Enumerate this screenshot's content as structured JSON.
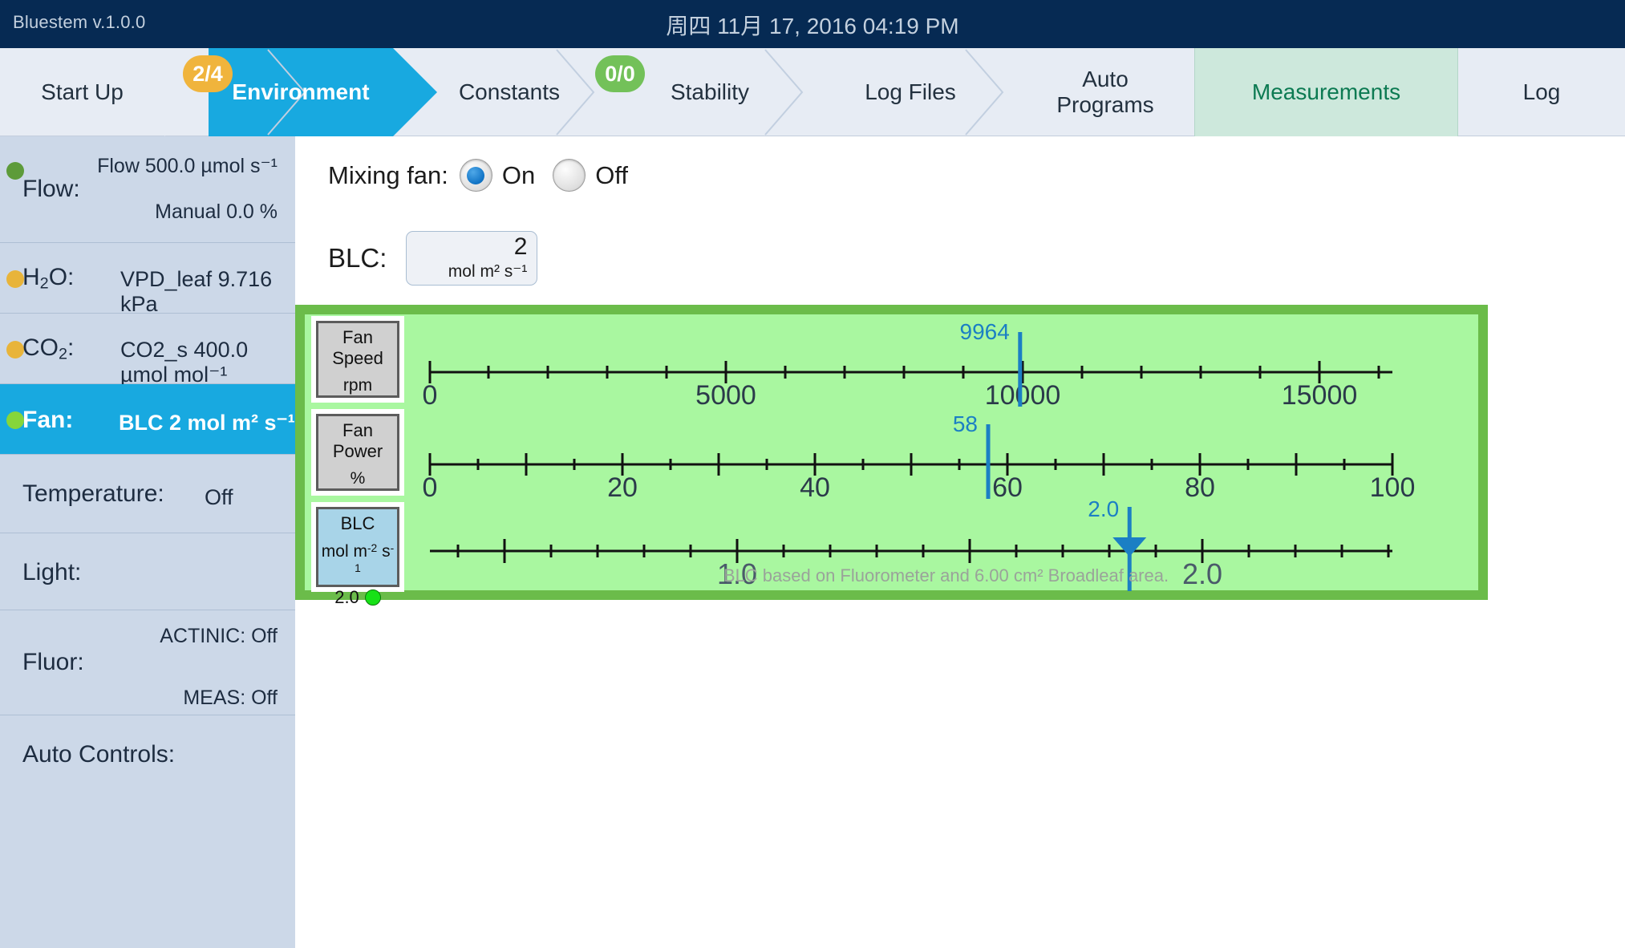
{
  "titlebar": {
    "app_name": "Bluestem v.1.0.0",
    "clock": "周四 11月 17, 2016 04:19 PM"
  },
  "tabs": [
    {
      "label": "Start Up",
      "badge": null,
      "state": "normal"
    },
    {
      "label": "Environment",
      "badge": "2/4",
      "badge_color": "#f0b43c",
      "state": "active-blue"
    },
    {
      "label": "Constants",
      "badge": null,
      "state": "normal"
    },
    {
      "label": "Stability",
      "badge": "0/0",
      "badge_color": "#73c159",
      "state": "normal"
    },
    {
      "label": "Log Files",
      "badge": null,
      "state": "normal"
    },
    {
      "label": "Auto\nPrograms",
      "label_l1": "Auto",
      "label_l2": "Programs",
      "badge": null,
      "state": "normal"
    },
    {
      "label": "Measurements",
      "badge": null,
      "state": "active-green"
    },
    {
      "label": "Log",
      "badge": null,
      "state": "normal"
    }
  ],
  "sidebar": {
    "items": [
      {
        "key": "Flow:",
        "dot": "green",
        "top": "Flow 500.0 µmol s⁻¹",
        "bottom": "Manual 0.0 %",
        "value": "",
        "selected": false
      },
      {
        "key": "H2O:",
        "dot": "yellow",
        "value": "VPD_leaf 9.716 kPa",
        "selected": false
      },
      {
        "key": "CO2:",
        "dot": "yellow",
        "value": "CO2_s 400.0 µmol mol⁻¹",
        "selected": false
      },
      {
        "key": "Fan:",
        "dot": "lgreen",
        "value": "BLC 2 mol m² s⁻¹",
        "selected": true
      },
      {
        "key": "Temperature:",
        "dot": null,
        "value": "Off",
        "selected": false
      },
      {
        "key": "Light:",
        "dot": null,
        "value": "",
        "selected": false
      },
      {
        "key": "Fluor:",
        "dot": null,
        "top": "ACTINIC: Off",
        "bottom": "MEAS: Off",
        "value": "",
        "selected": false
      },
      {
        "key": "Auto Controls:",
        "dot": null,
        "value": "",
        "selected": false
      }
    ]
  },
  "main": {
    "mixing_fan": {
      "label": "Mixing fan:",
      "on_label": "On",
      "off_label": "Off",
      "selected": "On"
    },
    "blc_input": {
      "label": "BLC:",
      "value": "2",
      "unit": "mol m² s⁻¹"
    },
    "panel": {
      "footnote": "BLC based on  Fluorometer and 6.00 cm²  Broadleaf area.",
      "gauge_boxes": [
        {
          "title": "Fan Speed",
          "unit": "rpm",
          "value": null,
          "led": false,
          "style": "grey"
        },
        {
          "title": "Fan Power",
          "unit": "%",
          "value": null,
          "led": false,
          "style": "grey"
        },
        {
          "title": "BLC",
          "unit": "mol m⁻² s⁻¹",
          "value": "2.0",
          "led": true,
          "style": "blue"
        }
      ]
    }
  },
  "chart_data": [
    {
      "type": "line",
      "title": "Fan Speed",
      "xlabel": "rpm",
      "ylabel": "",
      "xlim": [
        0,
        16250
      ],
      "tick_labels": [
        "0",
        "5000",
        "10000",
        "15000"
      ],
      "tick_values": [
        0,
        5000,
        10000,
        15000
      ],
      "minor_tick_step": 1000,
      "marker": {
        "value": 9964,
        "label": "9964",
        "color": "#1b7fc4",
        "shape": "line"
      },
      "grid": false
    },
    {
      "type": "line",
      "title": "Fan Power",
      "xlabel": "%",
      "ylabel": "",
      "xlim": [
        0,
        100
      ],
      "tick_labels": [
        "0",
        "20",
        "40",
        "60",
        "80",
        "100"
      ],
      "tick_values": [
        0,
        20,
        40,
        60,
        80,
        100
      ],
      "minor_tick_step": 5,
      "marker": {
        "value": 58,
        "label": "58",
        "color": "#1b7fc4",
        "shape": "line"
      },
      "grid": false
    },
    {
      "type": "line",
      "title": "BLC",
      "xlabel": "mol m-2 s-1",
      "ylabel": "",
      "xlim": [
        0.35,
        2.62
      ],
      "tick_labels": [
        "1.0",
        "2.0"
      ],
      "tick_values": [
        1.0,
        2.0
      ],
      "minor_tick_step": 0.1,
      "marker": {
        "value": 2.0,
        "label": "2.0",
        "color": "#1b7fc4",
        "shape": "triangle-down"
      },
      "grid": false
    }
  ]
}
